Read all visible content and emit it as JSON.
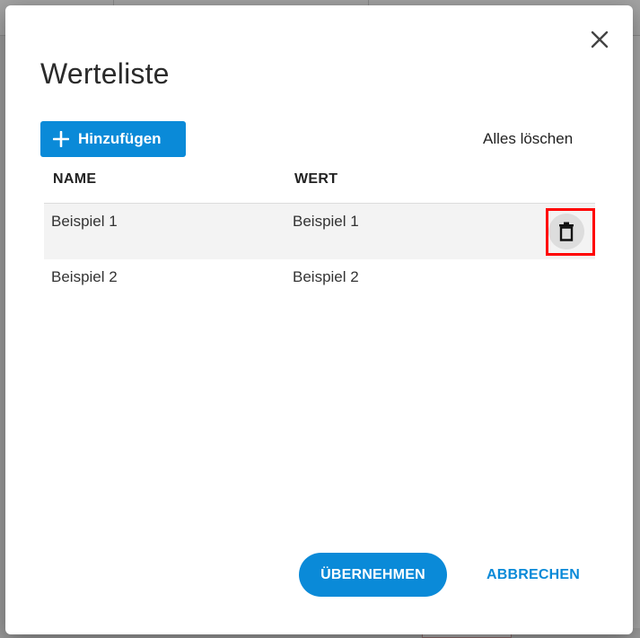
{
  "dialog": {
    "title": "Werteliste",
    "close_icon": "close-icon",
    "add_label": "Hinzufügen",
    "add_icon": "plus-icon",
    "clear_all_label": "Alles löschen",
    "apply_label": "ÜBERNEHMEN",
    "cancel_label": "ABBRECHEN"
  },
  "table": {
    "headers": {
      "name": "NAME",
      "value": "WERT"
    },
    "rows": [
      {
        "name": "Beispiel 1",
        "value": "Beispiel 1",
        "delete_icon": "trash-icon"
      },
      {
        "name": "Beispiel 2",
        "value": "Beispiel 2"
      }
    ]
  },
  "colors": {
    "accent": "#0a8ad8",
    "highlight_box": "#ff0000",
    "row_hover": "#f3f3f3"
  }
}
